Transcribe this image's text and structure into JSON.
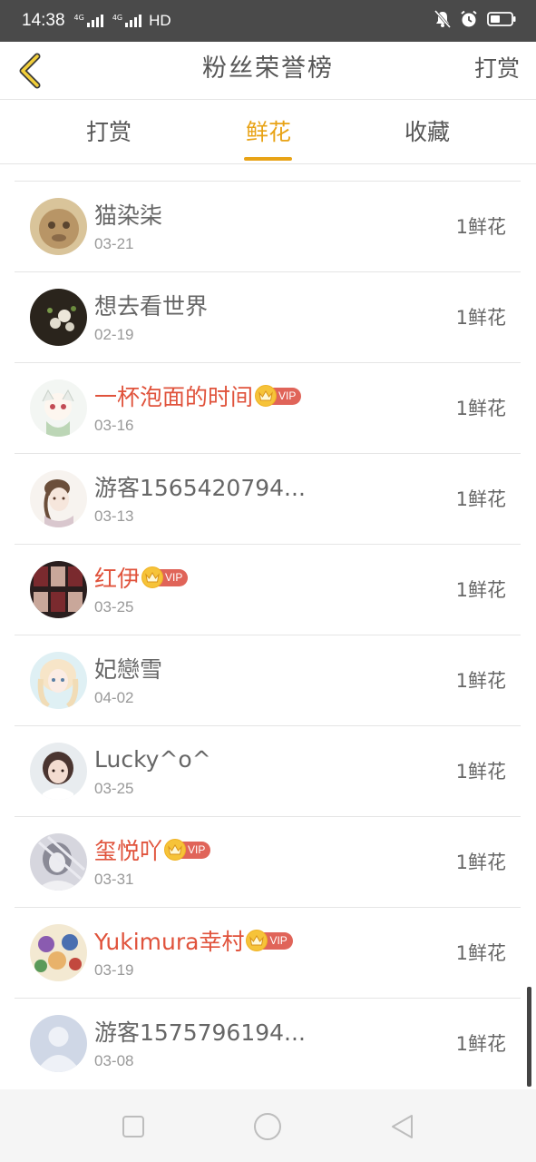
{
  "status_bar": {
    "time": "14:38",
    "signal1_label": "4G",
    "signal2_label": "4G",
    "hd_label": "HD"
  },
  "header": {
    "title": "粉丝荣誉榜",
    "tip_label": "打赏"
  },
  "tabs": [
    {
      "label": "打赏",
      "active": false
    },
    {
      "label": "鲜花",
      "active": true
    },
    {
      "label": "收藏",
      "active": false
    }
  ],
  "colors": {
    "accent": "#e8a316",
    "vip_name": "#e0533c",
    "vip_tag": "#e06459"
  },
  "vip_label": "VIP",
  "list": [
    {
      "name": "猫染柒",
      "date": "03-21",
      "amount": "1鲜花",
      "vip": false,
      "avatar": "avatar-1"
    },
    {
      "name": "想去看世界",
      "date": "02-19",
      "amount": "1鲜花",
      "vip": false,
      "avatar": "avatar-2"
    },
    {
      "name": "一杯泡面的时间",
      "date": "03-16",
      "amount": "1鲜花",
      "vip": true,
      "avatar": "avatar-3"
    },
    {
      "name": "游客1565420794...",
      "date": "03-13",
      "amount": "1鲜花",
      "vip": false,
      "avatar": "avatar-4"
    },
    {
      "name": "红伊",
      "date": "03-25",
      "amount": "1鲜花",
      "vip": true,
      "avatar": "avatar-5"
    },
    {
      "name": "妃戀雪",
      "date": "04-02",
      "amount": "1鲜花",
      "vip": false,
      "avatar": "avatar-6"
    },
    {
      "name": "Lucky^o^",
      "date": "03-25",
      "amount": "1鲜花",
      "vip": false,
      "avatar": "avatar-7"
    },
    {
      "name": "玺悦吖",
      "date": "03-31",
      "amount": "1鲜花",
      "vip": true,
      "avatar": "avatar-8"
    },
    {
      "name": "Yukimura幸村",
      "date": "03-19",
      "amount": "1鲜花",
      "vip": true,
      "avatar": "avatar-9"
    },
    {
      "name": "游客1575796194...",
      "date": "03-08",
      "amount": "1鲜花",
      "vip": false,
      "avatar": "default-avatar"
    }
  ]
}
